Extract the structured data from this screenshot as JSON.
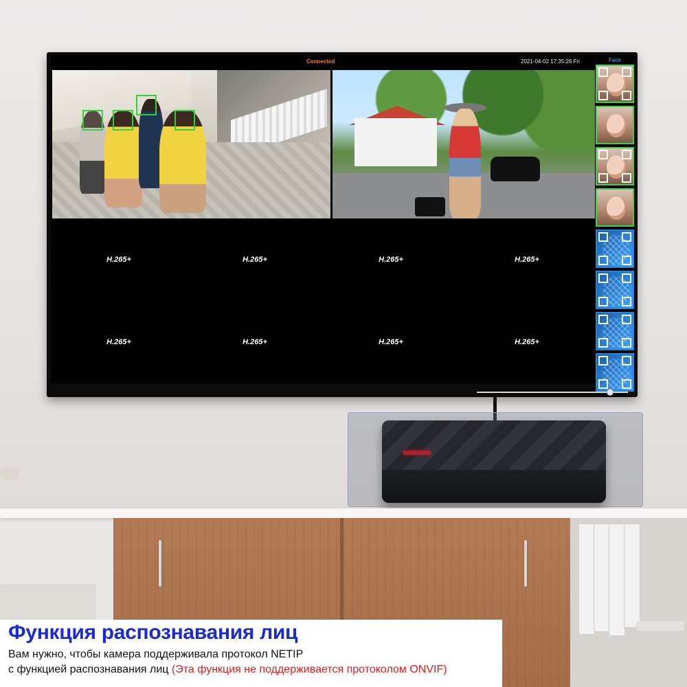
{
  "screen": {
    "status": "Connected",
    "datetime": "2021-04-02 17:35:26 Fri",
    "face_panel_label": "Face",
    "codec_cells": [
      "H.265+",
      "H.265+",
      "H.265+",
      "H.265+",
      "H.265+",
      "H.265+",
      "H.265+",
      "H.265+"
    ],
    "playback_position": 0.9,
    "face_thumbnails": [
      {
        "kind": "photo",
        "icon": "detected-face-icon"
      },
      {
        "kind": "photo",
        "icon": "detected-face-icon"
      },
      {
        "kind": "photo",
        "icon": "detected-face-icon"
      },
      {
        "kind": "photo",
        "icon": "detected-face-icon"
      },
      {
        "kind": "scan",
        "icon": "face-scan-icon"
      },
      {
        "kind": "scan",
        "icon": "face-scan-icon"
      },
      {
        "kind": "scan",
        "icon": "face-scan-icon"
      },
      {
        "kind": "scan",
        "icon": "face-scan-icon"
      }
    ]
  },
  "caption": {
    "title": "Функция распознавания лиц",
    "line1": "Вам нужно, чтобы камера поддерживала протокол NETIP",
    "line2_main": "с функцией распознавания лиц ",
    "line2_note": "(Эта функция не поддерживается протоколом ONVIF)"
  },
  "colors": {
    "status_connected": "#ff7a2a",
    "face_box": "#31d23a",
    "title_blue": "#1a2bd4",
    "note_red": "#e61a1a"
  }
}
